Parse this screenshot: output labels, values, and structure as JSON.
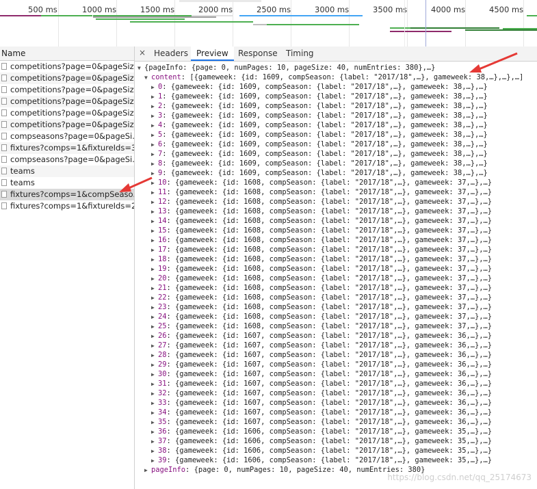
{
  "timeline": {
    "ticks": [
      "500 ms",
      "1000 ms",
      "1500 ms",
      "2000 ms",
      "2500 ms",
      "3000 ms",
      "3500 ms",
      "4000 ms",
      "4500 ms"
    ]
  },
  "name_panel": {
    "header": "Name",
    "requests": [
      "competitions?page=0&pageSiz...",
      "competitions?page=0&pageSiz...",
      "competitions?page=0&pageSiz...",
      "competitions?page=0&pageSiz...",
      "competitions?page=0&pageSiz...",
      "competitions?page=0&pageSiz...",
      "compseasons?page=0&pageSi...",
      "fixtures?comps=1&fixtureIds=3...",
      "compseasons?page=0&pageSi...",
      "teams",
      "teams",
      "fixtures?comps=1&compSeaso...",
      "fixtures?comps=1&fixtureIds=2..."
    ],
    "selected_index": 11
  },
  "tabs": {
    "close": "×",
    "items": [
      "Headers",
      "Preview",
      "Response",
      "Timing"
    ],
    "active": "Preview"
  },
  "preview": {
    "root": "{pageInfo: {page: 0, numPages: 10, pageSize: 40, numEntries: 380},…}",
    "content_key": "content",
    "content_summary": "[{gameweek: {id: 1609, compSeason: {label: \"2017/18\",…}, gameweek: 38,…},…},…]",
    "items": [
      {
        "i": "0",
        "id": "1609",
        "gw": "38"
      },
      {
        "i": "1",
        "id": "1609",
        "gw": "38"
      },
      {
        "i": "2",
        "id": "1609",
        "gw": "38"
      },
      {
        "i": "3",
        "id": "1609",
        "gw": "38"
      },
      {
        "i": "4",
        "id": "1609",
        "gw": "38"
      },
      {
        "i": "5",
        "id": "1609",
        "gw": "38"
      },
      {
        "i": "6",
        "id": "1609",
        "gw": "38"
      },
      {
        "i": "7",
        "id": "1609",
        "gw": "38"
      },
      {
        "i": "8",
        "id": "1609",
        "gw": "38"
      },
      {
        "i": "9",
        "id": "1609",
        "gw": "38"
      },
      {
        "i": "10",
        "id": "1608",
        "gw": "37"
      },
      {
        "i": "11",
        "id": "1608",
        "gw": "37"
      },
      {
        "i": "12",
        "id": "1608",
        "gw": "37"
      },
      {
        "i": "13",
        "id": "1608",
        "gw": "37"
      },
      {
        "i": "14",
        "id": "1608",
        "gw": "37"
      },
      {
        "i": "15",
        "id": "1608",
        "gw": "37"
      },
      {
        "i": "16",
        "id": "1608",
        "gw": "37"
      },
      {
        "i": "17",
        "id": "1608",
        "gw": "37"
      },
      {
        "i": "18",
        "id": "1608",
        "gw": "37"
      },
      {
        "i": "19",
        "id": "1608",
        "gw": "37"
      },
      {
        "i": "20",
        "id": "1608",
        "gw": "37"
      },
      {
        "i": "21",
        "id": "1608",
        "gw": "37"
      },
      {
        "i": "22",
        "id": "1608",
        "gw": "37"
      },
      {
        "i": "23",
        "id": "1608",
        "gw": "37"
      },
      {
        "i": "24",
        "id": "1608",
        "gw": "37"
      },
      {
        "i": "25",
        "id": "1608",
        "gw": "37"
      },
      {
        "i": "26",
        "id": "1607",
        "gw": "36"
      },
      {
        "i": "27",
        "id": "1607",
        "gw": "36"
      },
      {
        "i": "28",
        "id": "1607",
        "gw": "36"
      },
      {
        "i": "29",
        "id": "1607",
        "gw": "36"
      },
      {
        "i": "30",
        "id": "1607",
        "gw": "36"
      },
      {
        "i": "31",
        "id": "1607",
        "gw": "36"
      },
      {
        "i": "32",
        "id": "1607",
        "gw": "36"
      },
      {
        "i": "33",
        "id": "1607",
        "gw": "36"
      },
      {
        "i": "34",
        "id": "1607",
        "gw": "36"
      },
      {
        "i": "35",
        "id": "1607",
        "gw": "36"
      },
      {
        "i": "36",
        "id": "1606",
        "gw": "35"
      },
      {
        "i": "37",
        "id": "1606",
        "gw": "35"
      },
      {
        "i": "38",
        "id": "1606",
        "gw": "35"
      },
      {
        "i": "39",
        "id": "1606",
        "gw": "35"
      }
    ],
    "compseason_label": "\"2017/18\"",
    "pageinfo_key": "pageInfo",
    "pageinfo_value": "{page: 0, numPages: 10, pageSize: 40, numEntries: 380}"
  },
  "watermark": "https://blog.csdn.net/qq_25174673",
  "colors": {
    "accent": "#1a73e8",
    "arrow": "#e53935",
    "json_key": "#881280"
  }
}
